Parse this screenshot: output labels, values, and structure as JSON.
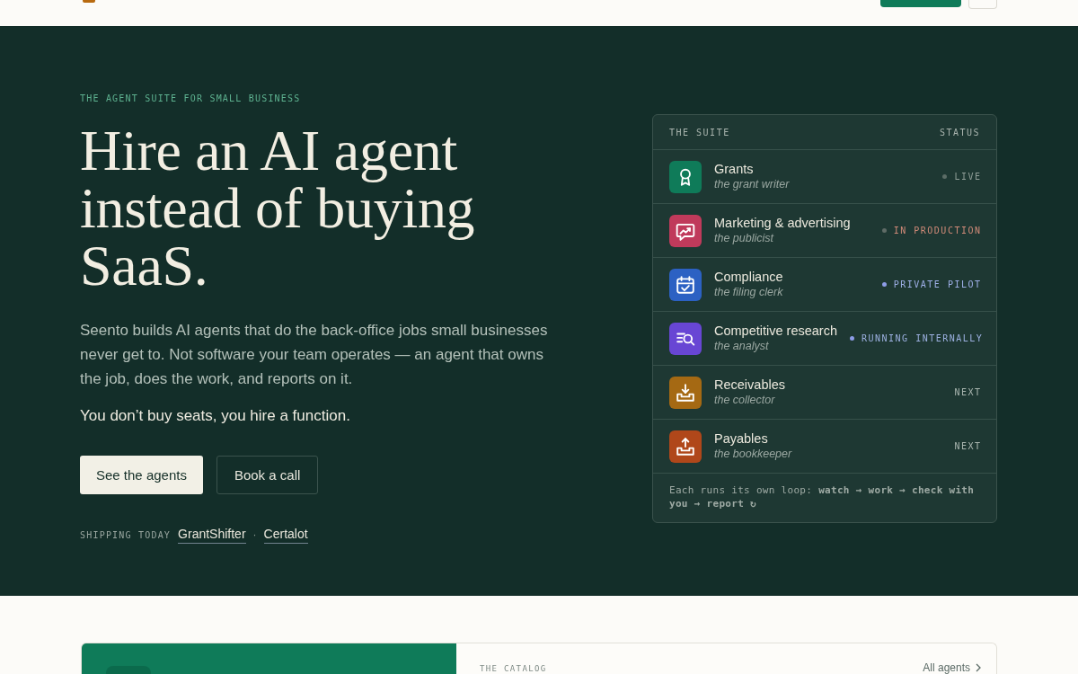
{
  "hero": {
    "eyebrow": "THE AGENT SUITE FOR SMALL BUSINESS",
    "headline": "Hire an AI agent instead of buying SaaS.",
    "body": "Seento builds AI agents that do the back-office jobs small businesses never get to. Not software your team operates — an agent that owns the job, does the work, and reports on it.",
    "tagline": "You don’t buy seats, you hire a function.",
    "buttons": [
      {
        "label": "See the agents",
        "kind": "primary"
      },
      {
        "label": "Book a call",
        "kind": "secondary"
      }
    ],
    "shipping": {
      "label": "SHIPPING TODAY",
      "links": [
        "GrantShifter",
        "Certalot"
      ],
      "separator": "·"
    }
  },
  "suite": {
    "title": "THE SUITE",
    "status_heading": "STATUS",
    "agents": [
      {
        "name": "Grants",
        "role": "the grant writer",
        "color": "#0f7b59",
        "status": {
          "label": "LIVE",
          "kind": "live"
        }
      },
      {
        "name": "Marketing & advertising",
        "role": "the publicist",
        "color": "#c03a5b",
        "status": {
          "label": "IN PRODUCTION",
          "kind": "production"
        }
      },
      {
        "name": "Compliance",
        "role": "the filing clerk",
        "color": "#2c61c3",
        "status": {
          "label": "PRIVATE PILOT",
          "kind": "pilot"
        }
      },
      {
        "name": "Competitive research",
        "role": "the analyst",
        "color": "#6846d4",
        "status": {
          "label": "RUNNING INTERNALLY",
          "kind": "internal"
        }
      },
      {
        "name": "Receivables",
        "role": "the collector",
        "color": "#a56913",
        "status": {
          "label": "NEXT",
          "kind": "next"
        }
      },
      {
        "name": "Payables",
        "role": "the bookkeeper",
        "color": "#b0471a",
        "status": {
          "label": "NEXT",
          "kind": "next"
        }
      }
    ],
    "footer": "Each runs its own loop: **watch → work → check with you → report ↻**"
  },
  "catalog": {
    "eyebrow": "THE CATALOG",
    "link": "All agents"
  }
}
